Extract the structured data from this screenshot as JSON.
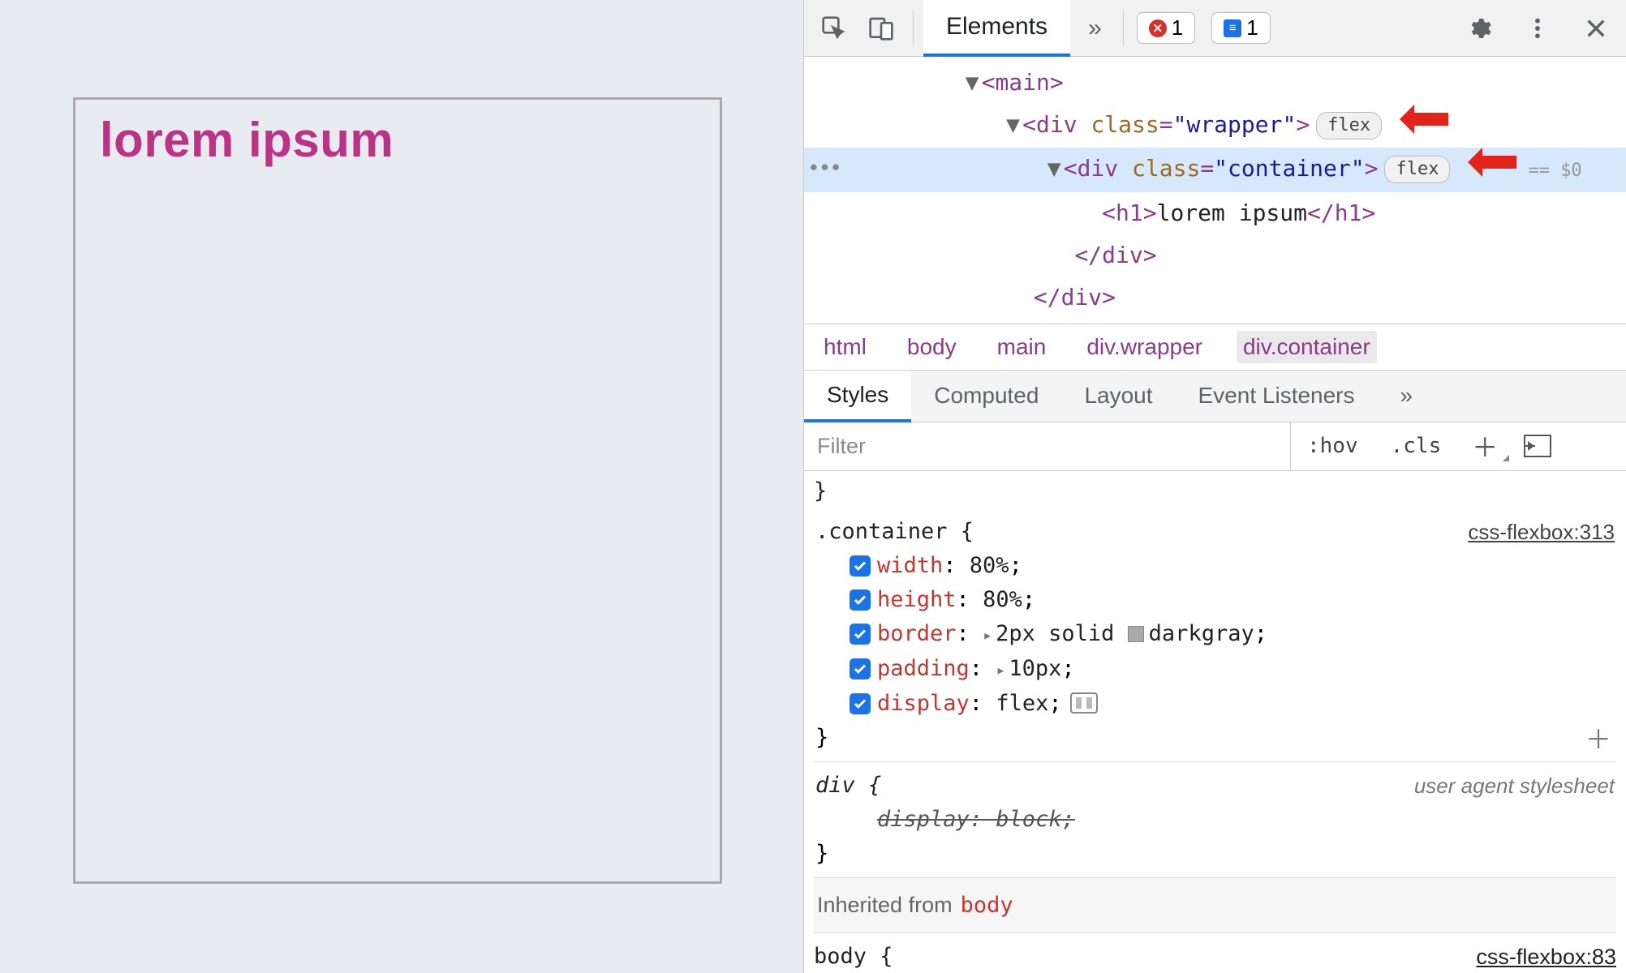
{
  "preview": {
    "heading": "lorem ipsum"
  },
  "toolbar": {
    "tab_elements": "Elements",
    "error_count": "1",
    "info_count": "1"
  },
  "dom": {
    "l1": "<main>",
    "l2_open": "<div ",
    "l2_attr": "class",
    "l2_val": "\"wrapper\"",
    "l2_close": ">",
    "l3_open": "<div ",
    "l3_attr": "class",
    "l3_val": "\"container\"",
    "l3_close": ">",
    "l4_open": "<h1>",
    "l4_text": "lorem ipsum",
    "l4_close": "</h1>",
    "l5": "</div>",
    "l6": "</div>",
    "flex_pill": "flex",
    "sel_marker": "== $0"
  },
  "breadcrumb": {
    "c1": "html",
    "c2": "body",
    "c3": "main",
    "c4": "div.wrapper",
    "c5": "div.container"
  },
  "subtabs": {
    "styles": "Styles",
    "computed": "Computed",
    "layout": "Layout",
    "listeners": "Event Listeners"
  },
  "filter": {
    "placeholder": "Filter",
    "hov": ":hov",
    "cls": ".cls"
  },
  "rules": {
    "brace_close_top": "}",
    "container": {
      "selector": ".container {",
      "source": "css-flexbox:313",
      "props": [
        {
          "name": "width",
          "val": "80%"
        },
        {
          "name": "height",
          "val": "80%"
        },
        {
          "name": "border",
          "val_pre": "2px solid ",
          "val_color": "darkgray",
          "expand": true,
          "swatch": true
        },
        {
          "name": "padding",
          "val": "10px",
          "expand": true
        },
        {
          "name": "display",
          "val": "flex",
          "flex_editor": true
        }
      ],
      "close": "}"
    },
    "div_ua": {
      "selector": "div {",
      "source": "user agent stylesheet",
      "prop": "display: block;",
      "close": "}"
    },
    "inherited_label": "Inherited from",
    "inherited_from": "body",
    "body_partial": {
      "selector": "body {",
      "source": "css-flexbox:83"
    }
  }
}
